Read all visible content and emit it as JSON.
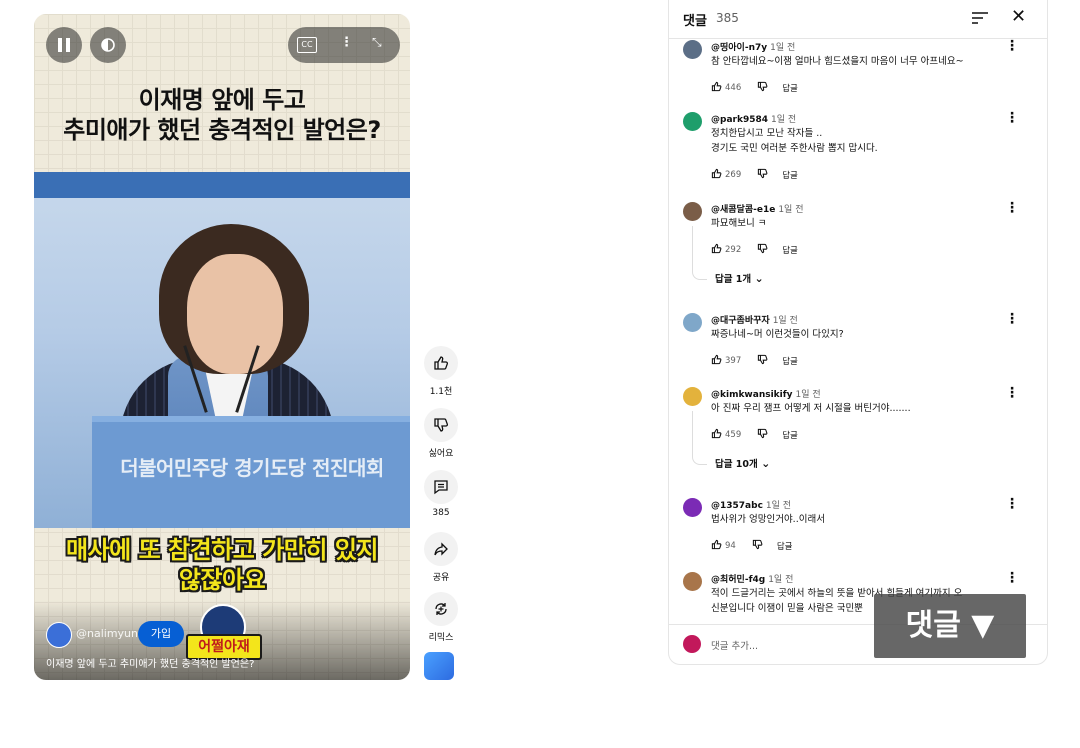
{
  "video": {
    "title_line1": "이재명 앞에 두고",
    "title_line2": "추미애가 했던 충격적인 발언은?",
    "podium_text": "더불어민주당 경기도당 전진대회",
    "subtitle_line1": "매사에 또 참견하고 가만히 있지",
    "subtitle_line2": "않잖아요",
    "channel": "@nalimyun",
    "join_label": "가입",
    "badge_text": "어쩔아재",
    "caption": "이재명 앞에 두고 추미애가 했던 충격적인 발언은?",
    "icons": [
      "pause-icon",
      "volume-icon",
      "cc-icon",
      "more-vert-icon",
      "fullscreen-icon"
    ]
  },
  "actions": {
    "like_count": "1.1천",
    "dislike_label": "싫어요",
    "comments_count": "385",
    "share_label": "공유",
    "remix_label": "리믹스"
  },
  "comments_panel": {
    "title": "댓글",
    "count": "385",
    "add_placeholder": "댓글 추가...",
    "reply_label": "답글",
    "comments": [
      {
        "author": "@띵아이-n7y",
        "time": "1일 전",
        "lines": [
          "참 안타깝네요~이잼 얼마나 힘드셨을지 마음이 너무 아프네요~"
        ],
        "likes": "446",
        "avatar_color": "#5b6e86"
      },
      {
        "author": "@park9584",
        "time": "1일 전",
        "lines": [
          "정치한답시고 모난 작자들 ..",
          "경기도 국민 여러분 주한사람 뽑지 맙시다."
        ],
        "likes": "269",
        "avatar_color": "#1e9e6b"
      },
      {
        "author": "@새콤달콤-e1e",
        "time": "1일 전",
        "lines": [
          "파묘해보니 ㅋ"
        ],
        "likes": "292",
        "avatar_color": "#7a5d48",
        "replies": "답글 1개"
      },
      {
        "author": "@대구좀바꾸자",
        "time": "1일 전",
        "lines": [
          "짜증나네~머 이런것들이 다있지?"
        ],
        "likes": "397",
        "avatar_color": "#7fa7c9"
      },
      {
        "author": "@kimkwansikify",
        "time": "1일 전",
        "lines": [
          "아 진짜 우리 잼프 어떻게 저 시절을 버틴거야......."
        ],
        "likes": "459",
        "avatar_color": "#e3b23c",
        "replies": "답글 10개"
      },
      {
        "author": "@1357abc",
        "time": "1일 전",
        "lines": [
          "법사위가 엉망인거야..이래서"
        ],
        "likes": "94",
        "avatar_color": "#7b2bb5"
      },
      {
        "author": "@최허민-f4g",
        "time": "1일 전",
        "lines": [
          "적이 드글거리는 곳에서 하늘의 뜻을 받아서 힘들게 여기까지 오",
          "신분입니다 이잼이 믿을 사람은 국민뿐"
        ],
        "likes": "",
        "avatar_color": "#a8754a"
      }
    ]
  },
  "overlay_label": "댓글 ▼"
}
